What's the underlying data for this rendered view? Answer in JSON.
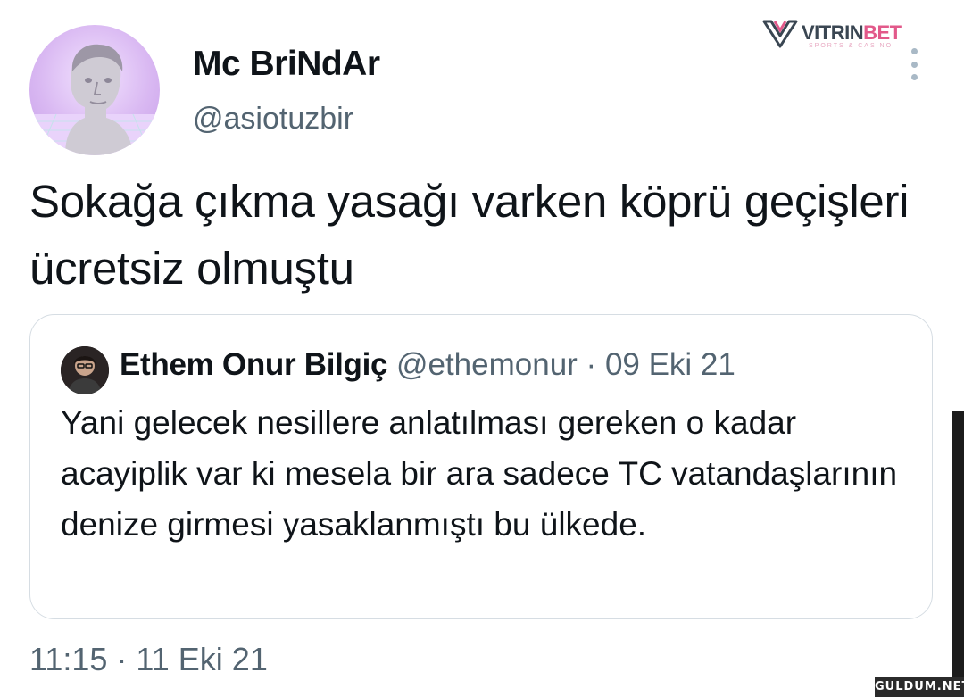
{
  "tweet": {
    "author": {
      "display_name": "Mc BriNdAr",
      "handle": "@asiotuzbir",
      "avatar": "statue-avatar"
    },
    "text": "Sokağa çıkma yasağı varken köprü geçişleri ücretsiz olmuştu",
    "timestamp": "11:15 · 11 Eki 21"
  },
  "quoted_tweet": {
    "author": {
      "display_name": "Ethem Onur Bilgiç",
      "handle": "@ethemonur",
      "avatar": "person-avatar"
    },
    "separator": "·",
    "date": "09 Eki 21",
    "text": "Yani gelecek nesillere anlatılması gereken o kadar acayiplik var ki mesela bir ara sadece TC vatandaşlarının denize girmesi yasaklanmıştı bu ülkede."
  },
  "more_menu": {
    "icon": "more-vertical-icon"
  },
  "overlay": {
    "brand_name_part1": "VITRIN",
    "brand_name_part2": "BET",
    "brand_subtitle": "SPORTS & CASINO",
    "watermark": "GULDUM.NET"
  },
  "colors": {
    "text_primary": "#0f1419",
    "text_secondary": "#536471",
    "border": "#d6dde3",
    "brand_accent": "#e2598a"
  }
}
